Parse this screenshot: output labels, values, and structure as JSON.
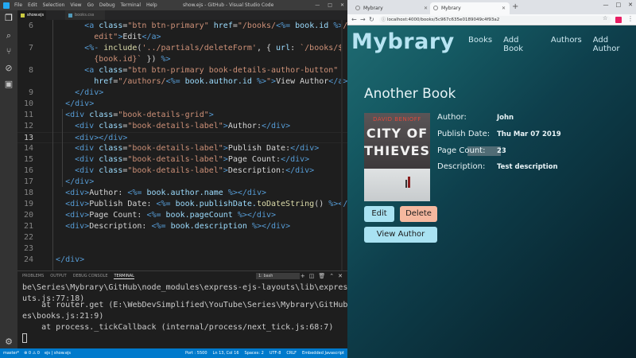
{
  "vscode": {
    "title": "show.ejs - GitHub - Visual Studio Code",
    "menu": [
      "File",
      "Edit",
      "Selection",
      "View",
      "Go",
      "Debug",
      "Terminal",
      "Help"
    ],
    "tabs": [
      {
        "label": "show.ejs",
        "active": true
      },
      {
        "label": "books.css",
        "active": false
      }
    ],
    "activity_icons": [
      "files-icon",
      "search-icon",
      "source-control-icon",
      "debug-icon",
      "extensions-icon",
      "settings-icon"
    ],
    "panel_tabs": [
      "PROBLEMS",
      "OUTPUT",
      "DEBUG CONSOLE",
      "TERMINAL"
    ],
    "terminal_select": "1: bash",
    "terminal_lines": [
      "be\\Series\\Mybrary\\GitHub\\node_modules\\express-ejs-layouts\\lib\\express-layo",
      "uts.js:77:18)",
      "    at router.get (E:\\WebDevSimplified\\YouTube\\Series\\Mybrary\\GitHub\\rout",
      "es\\books.js:21:9)",
      "    at process._tickCallback (internal/process/next_tick.js:68:7)"
    ],
    "status_left": [
      "master*",
      "⊗ 0  ⚠ 0",
      "ejs | show.ejs"
    ],
    "status_right": [
      "Port : 5500",
      "Ln 13, Col 16",
      "Spaces: 2",
      "UTF-8",
      "CRLF",
      "Embedded Javascript"
    ]
  },
  "editor": {
    "current_line": 13,
    "lines": [
      {
        "n": "6",
        "tokens": [
          [
            "pl",
            "        "
          ],
          [
            "tg",
            "<a "
          ],
          [
            "at",
            "class"
          ],
          [
            "pl",
            "="
          ],
          [
            "st",
            "\"btn btn-primary\""
          ],
          [
            "pl",
            " "
          ],
          [
            "at",
            "href"
          ],
          [
            "pl",
            "="
          ],
          [
            "st",
            "\"/books/"
          ],
          [
            "ej",
            "<%="
          ],
          [
            "vr",
            " book.id "
          ],
          [
            "ej",
            "%>"
          ],
          [
            "st",
            "/"
          ]
        ]
      },
      {
        "n": "",
        "tokens": [
          [
            "st",
            "          edit\""
          ],
          [
            "tg",
            ">"
          ],
          [
            "pl",
            "Edit"
          ],
          [
            "tg",
            "</a>"
          ]
        ]
      },
      {
        "n": "7",
        "tokens": [
          [
            "pl",
            "        "
          ],
          [
            "ej",
            "<%-"
          ],
          [
            "fn",
            " include"
          ],
          [
            "pl",
            "("
          ],
          [
            "st",
            "'../partials/deleteForm'"
          ],
          [
            "pl",
            ", { "
          ],
          [
            "vr",
            "url"
          ],
          [
            "pl",
            ": "
          ],
          [
            "st",
            "`/books/$"
          ]
        ]
      },
      {
        "n": "",
        "tokens": [
          [
            "st",
            "          {book.id}`"
          ],
          [
            "pl",
            " }) "
          ],
          [
            "ej",
            "%>"
          ]
        ]
      },
      {
        "n": "8",
        "tokens": [
          [
            "pl",
            "        "
          ],
          [
            "tg",
            "<a "
          ],
          [
            "at",
            "class"
          ],
          [
            "pl",
            "="
          ],
          [
            "st",
            "\"btn btn-primary book-details-author-button\""
          ]
        ]
      },
      {
        "n": "",
        "tokens": [
          [
            "pl",
            "          "
          ],
          [
            "at",
            "href"
          ],
          [
            "pl",
            "="
          ],
          [
            "st",
            "\"/authors/"
          ],
          [
            "ej",
            "<%="
          ],
          [
            "vr",
            " book.author.id "
          ],
          [
            "ej",
            "%>"
          ],
          [
            "st",
            "\""
          ],
          [
            "tg",
            ">"
          ],
          [
            "pl",
            "View Author"
          ],
          [
            "tg",
            "</a>"
          ]
        ]
      },
      {
        "n": "9",
        "tokens": [
          [
            "pl",
            "      "
          ],
          [
            "tg",
            "</div>"
          ]
        ]
      },
      {
        "n": "10",
        "tokens": [
          [
            "pl",
            "    "
          ],
          [
            "tg",
            "</div>"
          ]
        ]
      },
      {
        "n": "11",
        "tokens": [
          [
            "pl",
            "    "
          ],
          [
            "tg",
            "<div "
          ],
          [
            "at",
            "class"
          ],
          [
            "pl",
            "="
          ],
          [
            "st",
            "\"book-details-grid\""
          ],
          [
            "tg",
            ">"
          ]
        ]
      },
      {
        "n": "12",
        "tokens": [
          [
            "pl",
            "      "
          ],
          [
            "tg",
            "<div "
          ],
          [
            "at",
            "class"
          ],
          [
            "pl",
            "="
          ],
          [
            "st",
            "\"book-details-label\""
          ],
          [
            "tg",
            ">"
          ],
          [
            "pl",
            "Author:"
          ],
          [
            "tg",
            "</div>"
          ]
        ]
      },
      {
        "n": "13",
        "tokens": [
          [
            "pl",
            "      "
          ],
          [
            "tg",
            "<div>"
          ],
          [
            "tg",
            "</div>"
          ]
        ]
      },
      {
        "n": "14",
        "tokens": [
          [
            "pl",
            "      "
          ],
          [
            "tg",
            "<div "
          ],
          [
            "at",
            "class"
          ],
          [
            "pl",
            "="
          ],
          [
            "st",
            "\"book-details-label\""
          ],
          [
            "tg",
            ">"
          ],
          [
            "pl",
            "Publish Date:"
          ],
          [
            "tg",
            "</div>"
          ]
        ]
      },
      {
        "n": "15",
        "tokens": [
          [
            "pl",
            "      "
          ],
          [
            "tg",
            "<div "
          ],
          [
            "at",
            "class"
          ],
          [
            "pl",
            "="
          ],
          [
            "st",
            "\"book-details-label\""
          ],
          [
            "tg",
            ">"
          ],
          [
            "pl",
            "Page Count:"
          ],
          [
            "tg",
            "</div>"
          ]
        ]
      },
      {
        "n": "16",
        "tokens": [
          [
            "pl",
            "      "
          ],
          [
            "tg",
            "<div "
          ],
          [
            "at",
            "class"
          ],
          [
            "pl",
            "="
          ],
          [
            "st",
            "\"book-details-label\""
          ],
          [
            "tg",
            ">"
          ],
          [
            "pl",
            "Description:"
          ],
          [
            "tg",
            "</div>"
          ]
        ]
      },
      {
        "n": "17",
        "tokens": [
          [
            "pl",
            "    "
          ],
          [
            "tg",
            "</div>"
          ]
        ]
      },
      {
        "n": "18",
        "tokens": [
          [
            "pl",
            "    "
          ],
          [
            "tg",
            "<div>"
          ],
          [
            "pl",
            "Author: "
          ],
          [
            "ej",
            "<%="
          ],
          [
            "vr",
            " book.author.name "
          ],
          [
            "ej",
            "%>"
          ],
          [
            "tg",
            "</div>"
          ]
        ]
      },
      {
        "n": "19",
        "tokens": [
          [
            "pl",
            "    "
          ],
          [
            "tg",
            "<div>"
          ],
          [
            "pl",
            "Publish Date: "
          ],
          [
            "ej",
            "<%="
          ],
          [
            "vr",
            " book.publishDate."
          ],
          [
            "fn",
            "toDateString"
          ],
          [
            "pl",
            "() "
          ],
          [
            "ej",
            "%>"
          ],
          [
            "tg",
            "</div>"
          ]
        ]
      },
      {
        "n": "20",
        "tokens": [
          [
            "pl",
            "    "
          ],
          [
            "tg",
            "<div>"
          ],
          [
            "pl",
            "Page Count: "
          ],
          [
            "ej",
            "<%="
          ],
          [
            "vr",
            " book.pageCount "
          ],
          [
            "ej",
            "%>"
          ],
          [
            "tg",
            "</div>"
          ]
        ]
      },
      {
        "n": "21",
        "tokens": [
          [
            "pl",
            "    "
          ],
          [
            "tg",
            "<div>"
          ],
          [
            "pl",
            "Description: "
          ],
          [
            "ej",
            "<%="
          ],
          [
            "vr",
            " book.description "
          ],
          [
            "ej",
            "%>"
          ],
          [
            "tg",
            "</div>"
          ]
        ]
      },
      {
        "n": "22",
        "tokens": [
          [
            "pl",
            ""
          ]
        ]
      },
      {
        "n": "23",
        "tokens": [
          [
            "pl",
            ""
          ]
        ]
      },
      {
        "n": "24",
        "tokens": [
          [
            "pl",
            "  "
          ],
          [
            "tg",
            "</div>"
          ]
        ]
      }
    ]
  },
  "browser": {
    "tabs": [
      {
        "label": "Mybrary",
        "active": false
      },
      {
        "label": "Mybrary",
        "active": true
      }
    ],
    "url": "localhost:4000/books/5c967c635e0189049c4f93a2",
    "page": {
      "brand": "Mybrary",
      "nav": [
        "Books",
        "Add Book",
        "Authors",
        "Add Author"
      ],
      "book_title": "Another Book",
      "cover": {
        "author": "DAVID BENIOFF",
        "title_line1": "CITY OF",
        "title_line2": "THIEVES"
      },
      "details": [
        {
          "label": "Author:",
          "value": "John"
        },
        {
          "label": "Publish Date:",
          "value": "Thu Mar 07 2019"
        },
        {
          "label": "Page Count:",
          "value": "23"
        },
        {
          "label": "Description:",
          "value": "Test description"
        }
      ],
      "buttons": {
        "edit": "Edit",
        "delete": "Delete",
        "view_author": "View Author"
      }
    }
  }
}
